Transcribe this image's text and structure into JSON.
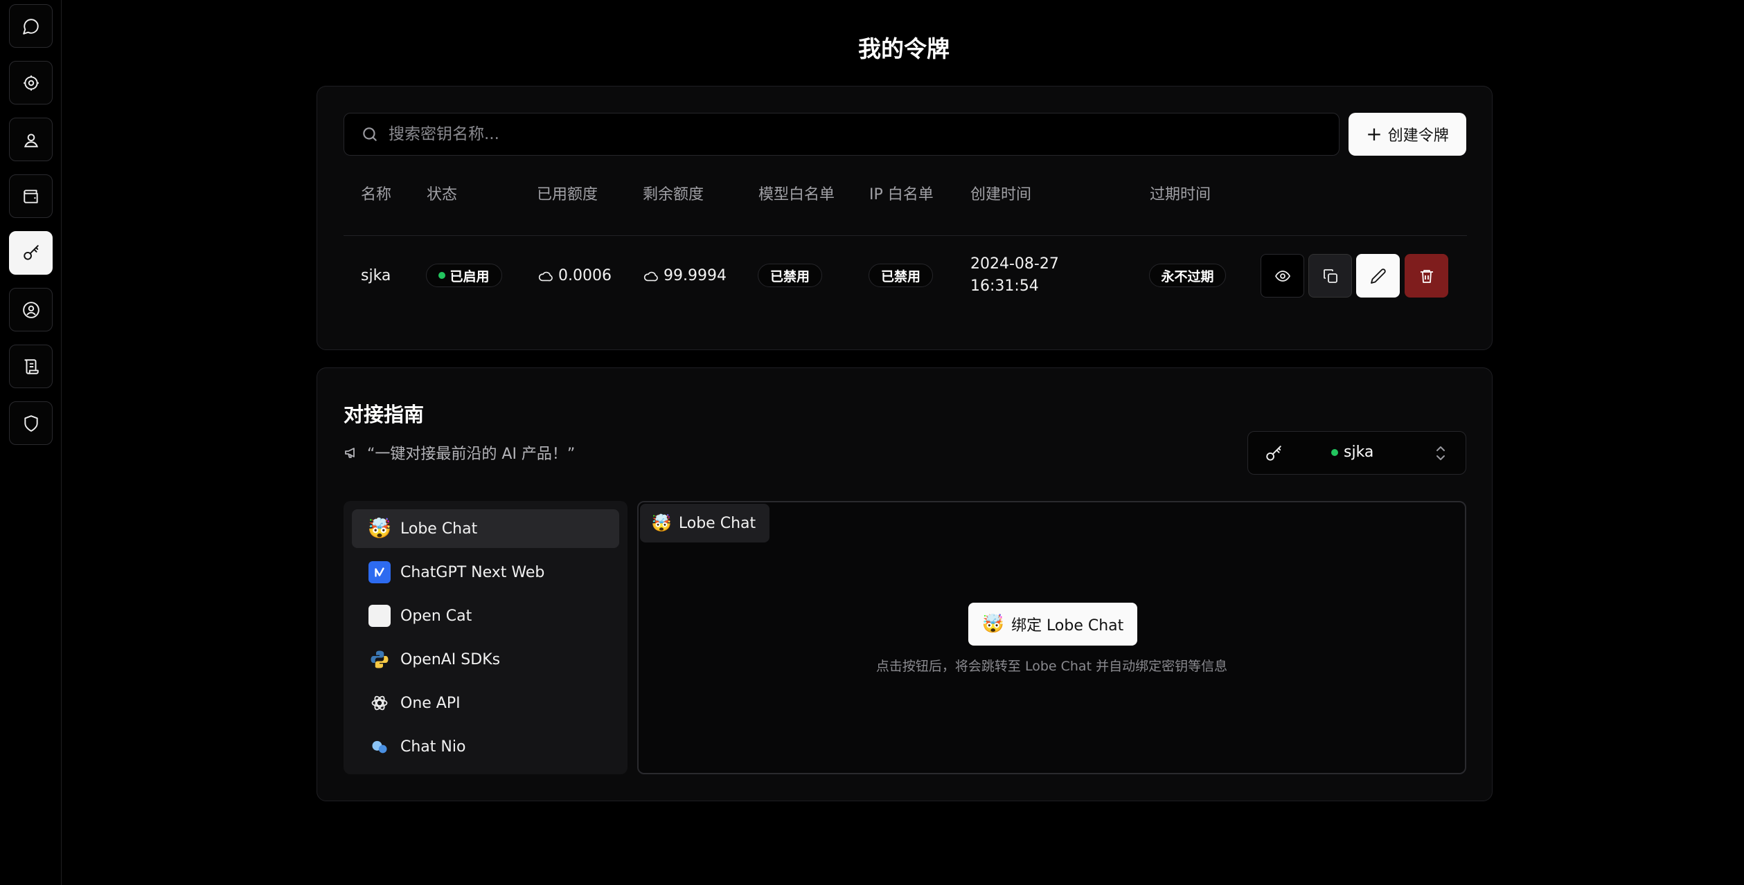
{
  "page": {
    "title": "我的令牌"
  },
  "sidebar": {
    "items": [
      {
        "icon": "chat-icon",
        "active": false
      },
      {
        "icon": "settings-icon",
        "active": false
      },
      {
        "icon": "user-badge-icon",
        "active": false
      },
      {
        "icon": "wallet-icon",
        "active": false
      },
      {
        "icon": "key-icon",
        "active": true
      },
      {
        "icon": "user-circle-icon",
        "active": false
      },
      {
        "icon": "scroll-icon",
        "active": false
      },
      {
        "icon": "shield-icon",
        "active": false
      }
    ]
  },
  "tokens": {
    "search_placeholder": "搜索密钥名称...",
    "create_label": "创建令牌",
    "columns": [
      "名称",
      "状态",
      "已用额度",
      "剩余额度",
      "模型白名单",
      "IP 白名单",
      "创建时间",
      "过期时间"
    ],
    "rows": [
      {
        "name": "sjka",
        "status": "已启用",
        "used": "0.0006",
        "remaining": "99.9994",
        "model_whitelist": "已禁用",
        "ip_whitelist": "已禁用",
        "created_date": "2024-08-27",
        "created_time": "16:31:54",
        "expires": "永不过期"
      }
    ]
  },
  "guide": {
    "title": "对接指南",
    "subtitle": "“一键对接最前沿的 AI 产品！”",
    "selected_key": "sjka",
    "apps": [
      {
        "name": "Lobe Chat",
        "icon": "🤯",
        "active": true
      },
      {
        "name": "ChatGPT Next Web",
        "icon": "nextweb-icon",
        "active": false
      },
      {
        "name": "Open Cat",
        "icon": "🐱",
        "active": false
      },
      {
        "name": "OpenAI SDKs",
        "icon": "python-icon",
        "active": false
      },
      {
        "name": "One API",
        "icon": "openai-icon",
        "active": false
      },
      {
        "name": "Chat Nio",
        "icon": "chatnio-icon",
        "active": false
      }
    ],
    "panel_tab": "Lobe Chat",
    "bind_label": "绑定 Lobe Chat",
    "bind_hint": "点击按钮后，将会跳转至 Lobe Chat 并自动绑定密钥等信息"
  },
  "colors": {
    "accent_green": "#22c55e",
    "danger": "#7f1d1d",
    "background": "#000000"
  }
}
